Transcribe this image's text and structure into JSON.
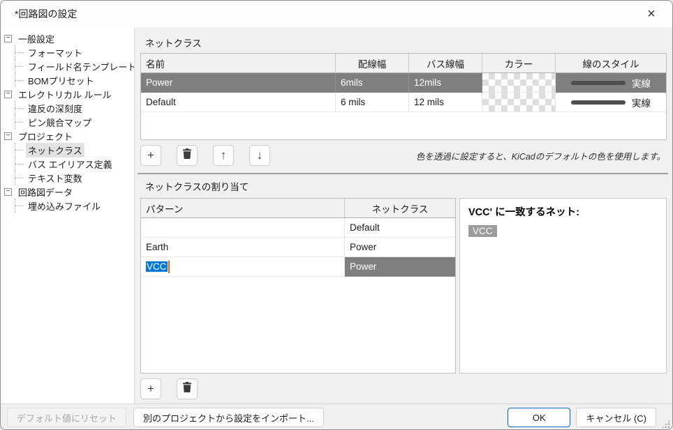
{
  "window": {
    "title": "*回路図の設定",
    "close_glyph": "×"
  },
  "sidebar": {
    "items": [
      {
        "label": "一般設定",
        "level": 0,
        "selected": false
      },
      {
        "label": "フォーマット",
        "level": 1,
        "selected": false
      },
      {
        "label": "フィールド名テンプレート",
        "level": 1,
        "selected": false
      },
      {
        "label": "BOMプリセット",
        "level": 1,
        "selected": false
      },
      {
        "label": "エレクトリカル ルール",
        "level": 0,
        "selected": false
      },
      {
        "label": "違反の深刻度",
        "level": 1,
        "selected": false
      },
      {
        "label": "ピン競合マップ",
        "level": 1,
        "selected": false
      },
      {
        "label": "プロジェクト",
        "level": 0,
        "selected": false
      },
      {
        "label": "ネットクラス",
        "level": 1,
        "selected": true
      },
      {
        "label": "バス エイリアス定義",
        "level": 1,
        "selected": false
      },
      {
        "label": "テキスト変数",
        "level": 1,
        "selected": false
      },
      {
        "label": "回路図データ",
        "level": 0,
        "selected": false
      },
      {
        "label": "埋め込みファイル",
        "level": 1,
        "selected": false
      }
    ],
    "collapse_glyph": "−"
  },
  "netclasses": {
    "section_title": "ネットクラス",
    "columns": [
      "名前",
      "配線幅",
      "バス線幅",
      "カラー",
      "線のスタイル"
    ],
    "rows": [
      {
        "name": "Power",
        "wire_width": "6mils",
        "bus_width": "12mils",
        "color": "transparent",
        "line_style": "実線",
        "selected": true
      },
      {
        "name": "Default",
        "wire_width": "6 mils",
        "bus_width": "12 mils",
        "color": "transparent",
        "line_style": "実線",
        "selected": false
      }
    ],
    "toolbar": {
      "add": "+",
      "up": "↑",
      "down": "↓"
    },
    "hint": "色を透過に設定すると、KiCadのデフォルトの色を使用します。"
  },
  "assignments": {
    "section_title": "ネットクラスの割り当て",
    "columns": [
      "パターン",
      "ネットクラス"
    ],
    "rows": [
      {
        "pattern": "",
        "netclass": "Default",
        "editing": false,
        "selected": false
      },
      {
        "pattern": "Earth",
        "netclass": "Power",
        "editing": false,
        "selected": false
      },
      {
        "pattern": "VCC",
        "netclass": "Power",
        "editing": true,
        "selected": true
      }
    ],
    "toolbar": {
      "add": "+"
    },
    "match_panel": {
      "title": "VCC' に一致するネット:",
      "nets": [
        "VCC"
      ]
    }
  },
  "footer": {
    "reset_label": "デフォルト値にリセット",
    "import_label": "別のプロジェクトから設定をインポート...",
    "ok_label": "OK",
    "cancel_label": "キャンセル (C)"
  },
  "colors": {
    "selection_gray": "#7f7f7f",
    "selection_blue": "#0078d7",
    "ok_border_blue": "#0067c0"
  }
}
